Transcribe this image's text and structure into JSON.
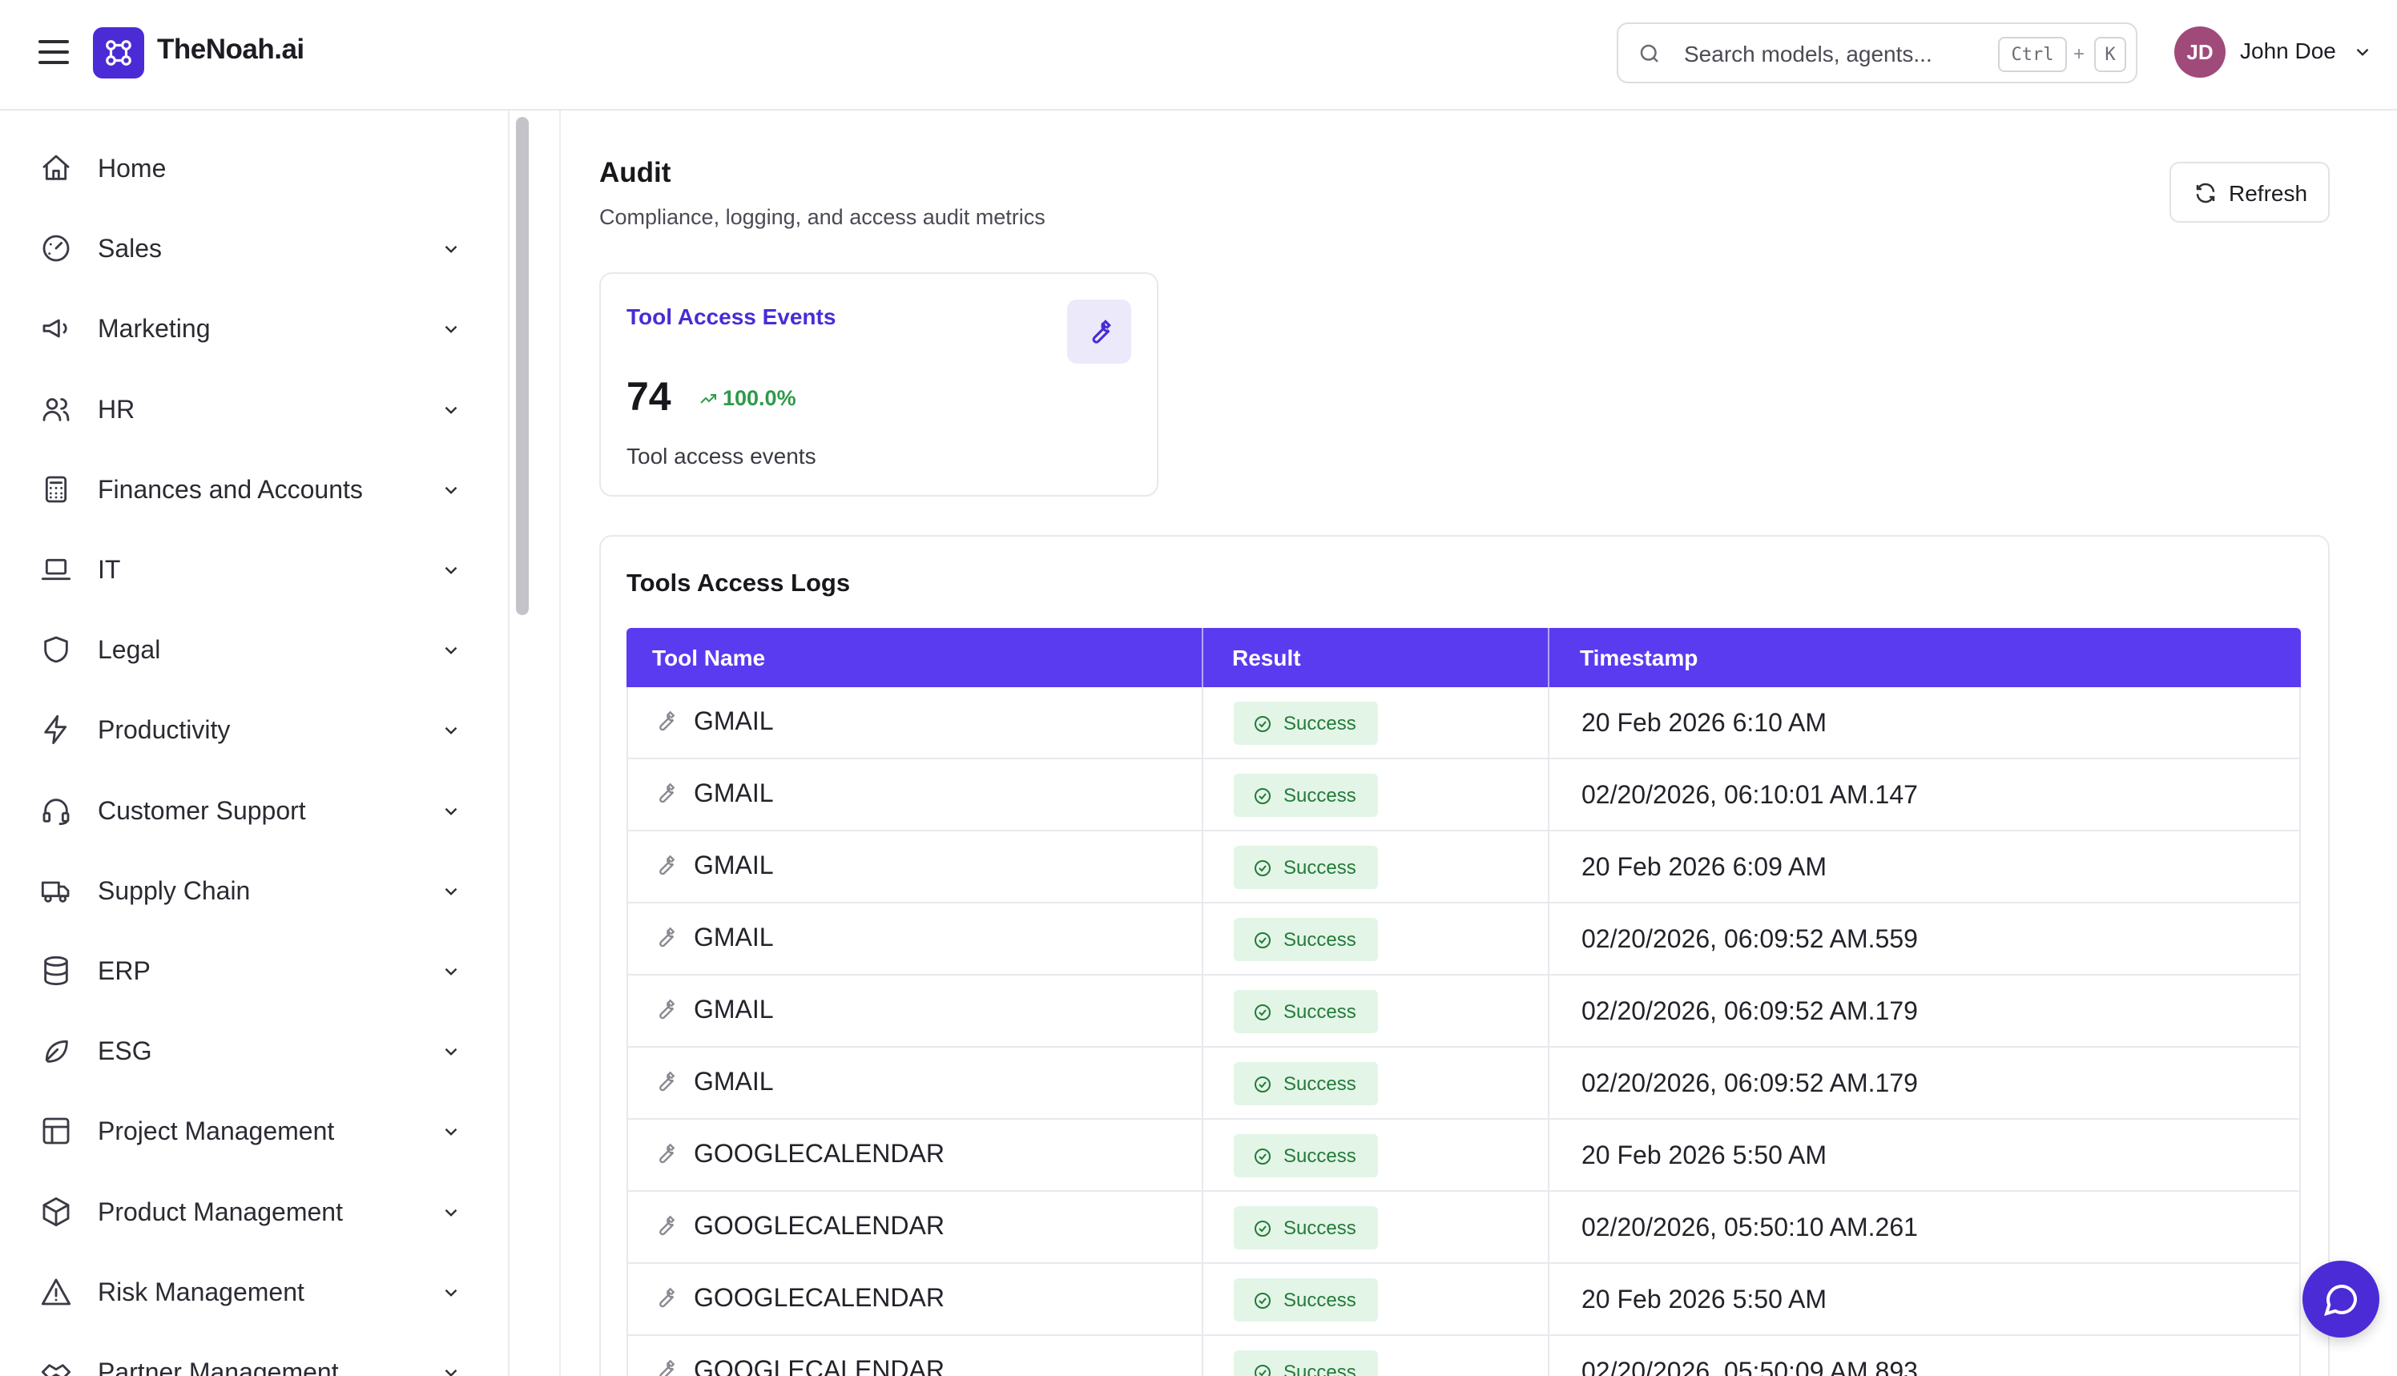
{
  "header": {
    "brand": "TheNoah.ai",
    "search_placeholder": "Search models, agents...",
    "shortcut_ctrl": "Ctrl",
    "shortcut_plus": "+",
    "shortcut_key": "K",
    "user_initials": "JD",
    "user_name": "John Doe"
  },
  "sidebar": {
    "items": [
      {
        "label": "Home",
        "icon": "home-icon",
        "expandable": false
      },
      {
        "label": "Sales",
        "icon": "gauge-icon",
        "expandable": true
      },
      {
        "label": "Marketing",
        "icon": "megaphone-icon",
        "expandable": true
      },
      {
        "label": "HR",
        "icon": "users-icon",
        "expandable": true
      },
      {
        "label": "Finances and Accounts",
        "icon": "calculator-icon",
        "expandable": true
      },
      {
        "label": "IT",
        "icon": "laptop-icon",
        "expandable": true
      },
      {
        "label": "Legal",
        "icon": "shield-icon",
        "expandable": true
      },
      {
        "label": "Productivity",
        "icon": "lightning-icon",
        "expandable": true
      },
      {
        "label": "Customer Support",
        "icon": "headset-icon",
        "expandable": true
      },
      {
        "label": "Supply Chain",
        "icon": "truck-icon",
        "expandable": true
      },
      {
        "label": "ERP",
        "icon": "database-icon",
        "expandable": true
      },
      {
        "label": "ESG",
        "icon": "leaf-icon",
        "expandable": true
      },
      {
        "label": "Project Management",
        "icon": "layout-icon",
        "expandable": true
      },
      {
        "label": "Product Management",
        "icon": "package-icon",
        "expandable": true
      },
      {
        "label": "Risk Management",
        "icon": "warning-icon",
        "expandable": true
      },
      {
        "label": "Partner Management",
        "icon": "handshake-icon",
        "expandable": true
      }
    ]
  },
  "page": {
    "title": "Audit",
    "subtitle": "Compliance, logging, and access audit metrics",
    "refresh_label": "Refresh"
  },
  "stat": {
    "title": "Tool Access Events",
    "value": "74",
    "delta": "100.0%",
    "description": "Tool access events"
  },
  "logs": {
    "title": "Tools Access Logs",
    "columns": [
      "Tool Name",
      "Result",
      "Timestamp"
    ],
    "rows": [
      {
        "tool": "GMAIL",
        "result": "Success",
        "timestamp": "20 Feb 2026 6:10 AM"
      },
      {
        "tool": "GMAIL",
        "result": "Success",
        "timestamp": "02/20/2026, 06:10:01 AM.147"
      },
      {
        "tool": "GMAIL",
        "result": "Success",
        "timestamp": "20 Feb 2026 6:09 AM"
      },
      {
        "tool": "GMAIL",
        "result": "Success",
        "timestamp": "02/20/2026, 06:09:52 AM.559"
      },
      {
        "tool": "GMAIL",
        "result": "Success",
        "timestamp": "02/20/2026, 06:09:52 AM.179"
      },
      {
        "tool": "GMAIL",
        "result": "Success",
        "timestamp": "02/20/2026, 06:09:52 AM.179"
      },
      {
        "tool": "GOOGLECALENDAR",
        "result": "Success",
        "timestamp": "20 Feb 2026 5:50 AM"
      },
      {
        "tool": "GOOGLECALENDAR",
        "result": "Success",
        "timestamp": "02/20/2026, 05:50:10 AM.261"
      },
      {
        "tool": "GOOGLECALENDAR",
        "result": "Success",
        "timestamp": "20 Feb 2026 5:50 AM"
      },
      {
        "tool": "GOOGLECALENDAR",
        "result": "Success",
        "timestamp": "02/20/2026, 05:50:09 AM.893"
      }
    ]
  },
  "colors": {
    "accent": "#5b3bf0",
    "brand": "#4a2bd6",
    "success_bg": "#e3f5e6",
    "success_text": "#237a3b"
  }
}
